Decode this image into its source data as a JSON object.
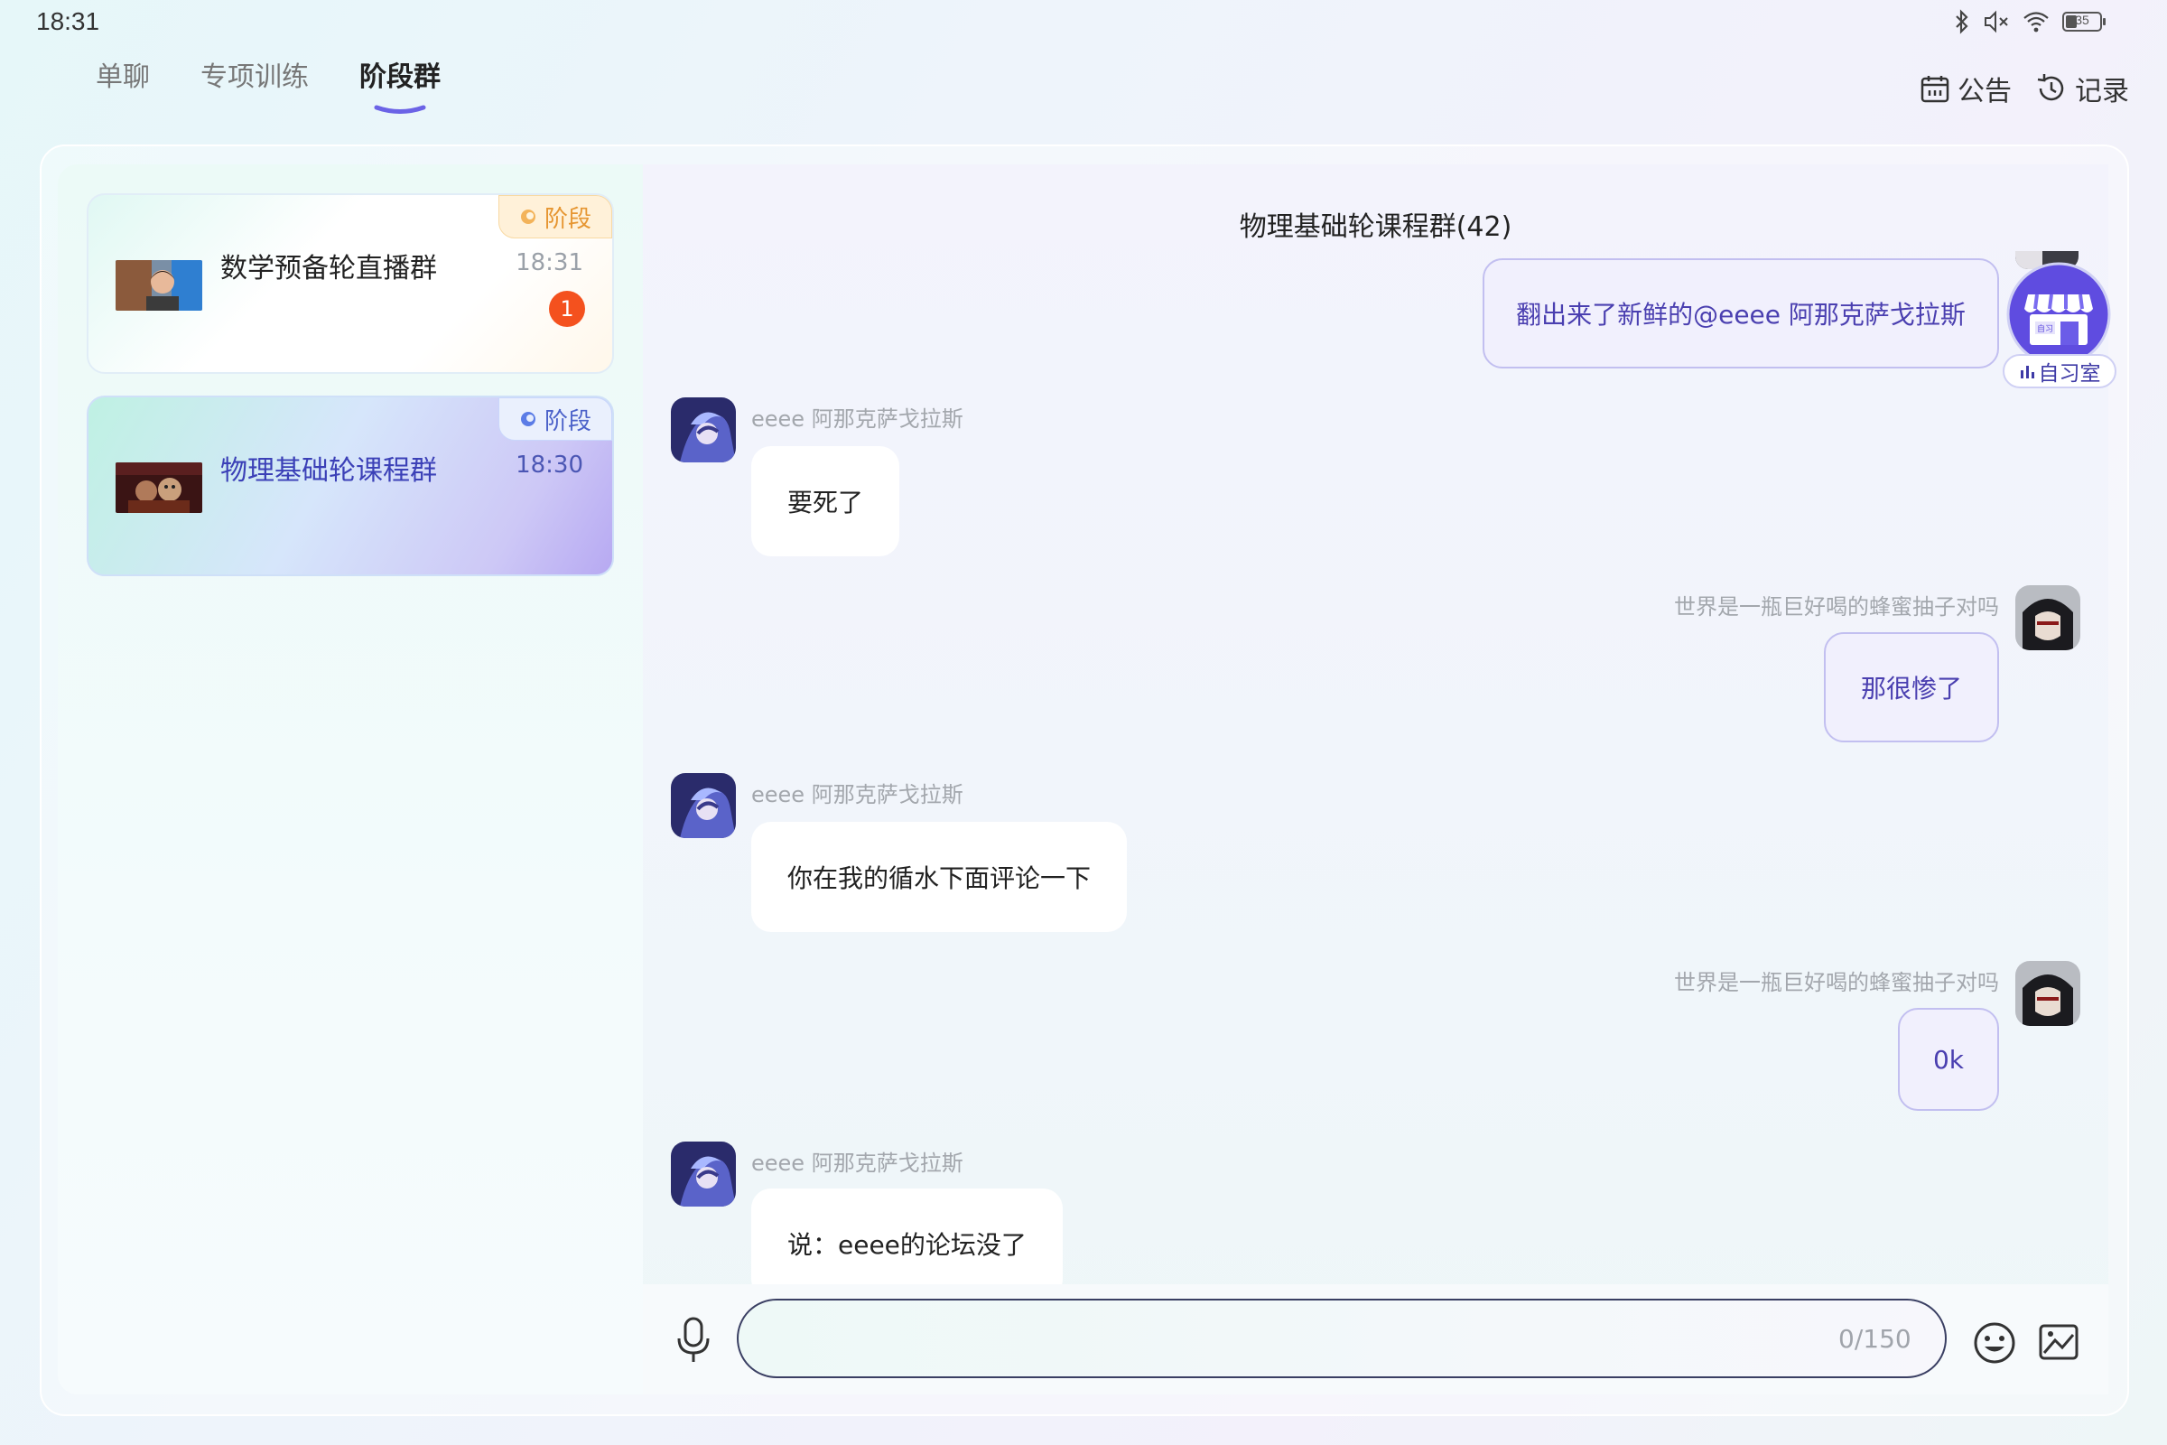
{
  "status_bar": {
    "time": "18:31",
    "battery": "35"
  },
  "tabs": [
    {
      "label": "单聊"
    },
    {
      "label": "专项训练"
    },
    {
      "label": "阶段群"
    }
  ],
  "top_actions": {
    "notice_label": "公告",
    "records_label": "记录"
  },
  "conversations": [
    {
      "badge": "阶段",
      "name": "数学预备轮直播群",
      "time": "18:31",
      "unread": "1"
    },
    {
      "badge": "阶段",
      "name": "物理基础轮课程群",
      "time": "18:30"
    }
  ],
  "chat": {
    "title": "物理基础轮课程群(42)",
    "messages": [
      {
        "direction": "out",
        "text": "翻出来了新鲜的@eeee 阿那克萨戈拉斯"
      },
      {
        "direction": "in",
        "sender": "eeee 阿那克萨戈拉斯",
        "text": "要死了"
      },
      {
        "direction": "out",
        "sender": "世界是一瓶巨好喝的蜂蜜抽子对吗",
        "text": "那很惨了"
      },
      {
        "direction": "in",
        "sender": "eeee 阿那克萨戈拉斯",
        "text": "你在我的循水下面评论一下"
      },
      {
        "direction": "out",
        "sender": "世界是一瓶巨好喝的蜂蜜抽子对吗",
        "text": "0k"
      },
      {
        "direction": "in",
        "sender": "eeee 阿那克萨戈拉斯",
        "text": "说：eeee的论坛没了"
      }
    ]
  },
  "floating": {
    "study_room_label": "自习室",
    "study_room_icon_text": "自习"
  },
  "composer": {
    "counter": "0/150",
    "value": ""
  },
  "colors": {
    "accent": "#4a3fb0",
    "unread": "#f4511e",
    "stage_orange": "#e69632",
    "stage_blue": "#4c62c9"
  }
}
